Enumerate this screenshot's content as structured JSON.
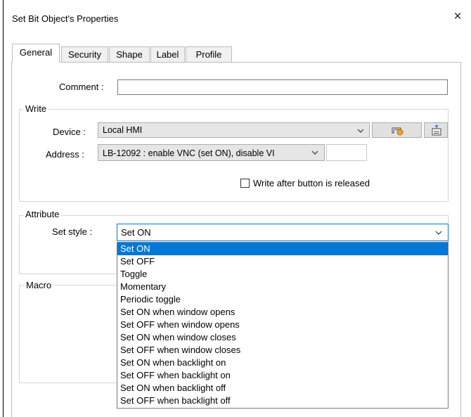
{
  "window": {
    "title": "Set Bit Object's Properties",
    "close_glyph": "×"
  },
  "tabs": [
    {
      "label": "General",
      "active": true
    },
    {
      "label": "Security",
      "active": false
    },
    {
      "label": "Shape",
      "active": false
    },
    {
      "label": "Label",
      "active": false
    },
    {
      "label": "Profile",
      "active": false
    }
  ],
  "comment": {
    "label": "Comment :",
    "value": ""
  },
  "write": {
    "group_title": "Write",
    "device_label": "Device :",
    "device_value": "Local HMI",
    "address_label": "Address :",
    "address_value": "LB-12092 : enable VNC (set ON), disable VI",
    "address_extra": "",
    "write_after_release_label": "Write after button is released",
    "write_after_release_checked": false,
    "icons": [
      "device-settings-icon",
      "address-book-icon"
    ]
  },
  "attribute": {
    "group_title": "Attribute",
    "set_style_label": "Set style :",
    "set_style_value": "Set ON",
    "options": [
      "Set ON",
      "Set OFF",
      "Toggle",
      "Momentary",
      "Periodic toggle",
      "Set ON when window opens",
      "Set OFF when window opens",
      "Set ON when window closes",
      "Set OFF when window closes",
      "Set ON when backlight on",
      "Set OFF when backlight on",
      "Set ON when backlight off",
      "Set OFF when backlight off"
    ],
    "selected_index": 0
  },
  "macro": {
    "group_title": "Macro"
  },
  "colors": {
    "selection": "#0078d7",
    "accent_orange": "#f0a030",
    "border": "#adadad"
  }
}
